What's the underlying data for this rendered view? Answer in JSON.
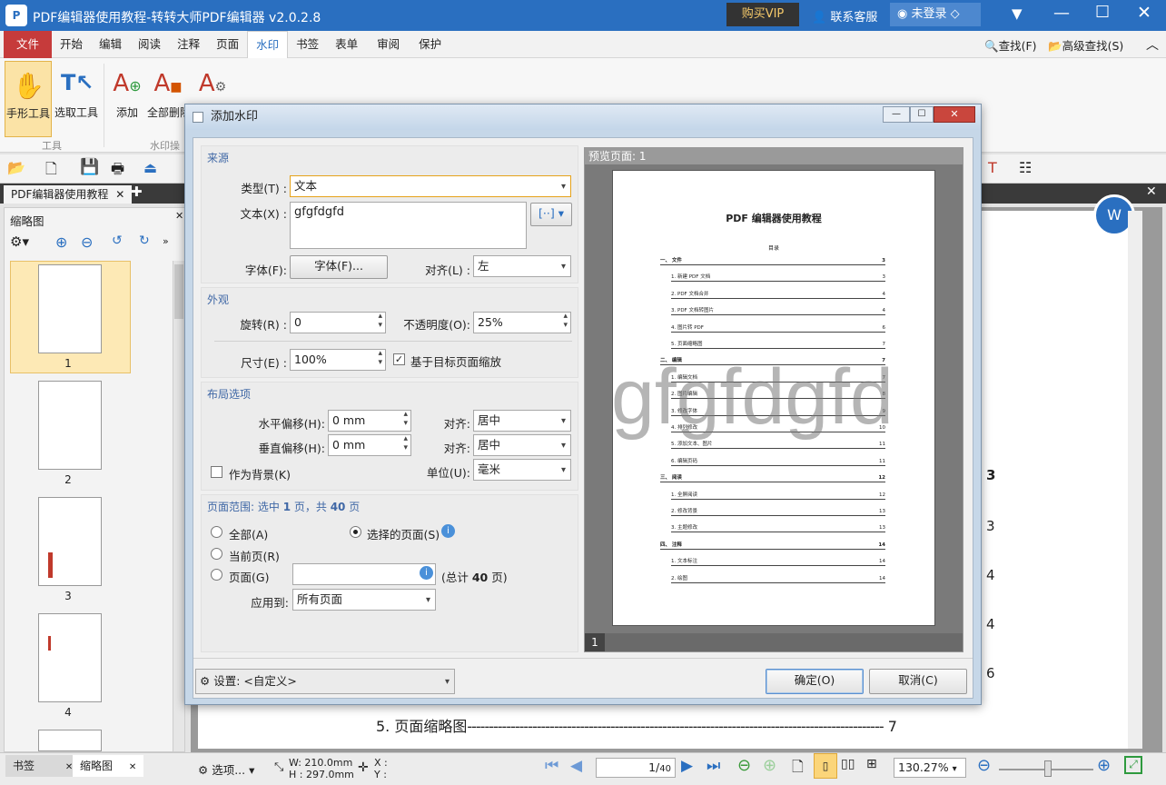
{
  "app": {
    "title": "PDF编辑器使用教程-转转大师PDF编辑器 v2.0.2.8",
    "vip": "购买VIP",
    "support": "联系客服",
    "login": "未登录"
  },
  "menu": {
    "items": [
      "文件",
      "开始",
      "编辑",
      "阅读",
      "注释",
      "页面",
      "水印",
      "书签",
      "表单",
      "审阅",
      "保护"
    ],
    "find": "查找(F)",
    "adv_find": "高级查找(S)"
  },
  "ribbon": {
    "hand": "手形工具",
    "select": "选取工具",
    "add": "添加",
    "delete_all": "全部删除",
    "group_tools": "工具",
    "group_wm": "水印操"
  },
  "doc_tab": "PDF编辑器使用教程",
  "left_panel": {
    "title": "缩略图",
    "pages": [
      "1",
      "2",
      "3",
      "4"
    ]
  },
  "document": {
    "lines": [
      {
        "label": "5.  页面缩略图",
        "page": "7"
      }
    ],
    "side_nums": [
      "3",
      "3",
      "4",
      "4",
      "6"
    ]
  },
  "status": {
    "bookmarks": "书签",
    "thumbs": "缩略图",
    "options": "选项...",
    "size_w": "W: 210.0mm",
    "size_h": "H : 297.0mm",
    "x": "X :",
    "y": "Y :",
    "page": "1",
    "total": "40",
    "zoom": "130.27%"
  },
  "dialog": {
    "title": "添加水印",
    "source": {
      "header": "来源",
      "type_label": "类型(T) :",
      "type_value": "文本",
      "text_label": "文本(X) :",
      "text_value": "gfgfdgfd",
      "font_label": "字体(F):",
      "font_button": "字体(F)...",
      "align_label": "对齐(L) :",
      "align_value": "左"
    },
    "appearance": {
      "header": "外观",
      "rotate_label": "旋转(R) :",
      "rotate_value": "0",
      "opacity_label": "不透明度(O):",
      "opacity_value": "25%",
      "size_label": "尺寸(E) :",
      "size_value": "100%",
      "scale_check": "基于目标页面缩放"
    },
    "layout": {
      "header": "布局选项",
      "h_offset_label": "水平偏移(H):",
      "h_offset_value": "0 mm",
      "v_offset_label": "垂直偏移(H):",
      "v_offset_value": "0 mm",
      "align1_label": "对齐:",
      "align1_value": "居中",
      "align2_label": "对齐:",
      "align2_value": "居中",
      "background_check": "作为背景(K)",
      "unit_label": "单位(U):",
      "unit_value": "毫米"
    },
    "range": {
      "header_prefix": "页面范围: 选中 ",
      "selected": "1",
      "header_mid": " 页，共 ",
      "total": "40",
      "header_suffix": " 页",
      "all": "全部(A)",
      "selected_pages": "选择的页面(S)",
      "current": "当前页(R)",
      "pages": "页面(G)",
      "pages_total_prefix": "(总计 ",
      "pages_total_suffix": " 页)",
      "apply_label": "应用到:",
      "apply_value": "所有页面"
    },
    "settings": {
      "label": "设置:",
      "value": "<自定义>"
    },
    "ok": "确定(O)",
    "cancel": "取消(C)",
    "preview": {
      "header": "预览页面: 1",
      "page_num": "1",
      "doc_title": "PDF 编辑器使用教程",
      "toc": "目录",
      "watermark": "gfgfdgfd",
      "entries": [
        {
          "t": "一、 文件",
          "p": "3"
        },
        {
          "t": "1. 新建 PDF 文档",
          "p": "3"
        },
        {
          "t": "2. PDF 文档合并",
          "p": "4"
        },
        {
          "t": "3. PDF 文档转图片",
          "p": "4"
        },
        {
          "t": "4. 图片转 PDF",
          "p": "6"
        },
        {
          "t": "5. 页面缩略图",
          "p": "7"
        },
        {
          "t": "二、 编辑",
          "p": "7"
        },
        {
          "t": "1. 编辑文档",
          "p": "7"
        },
        {
          "t": "2. 图片编辑",
          "p": "8"
        },
        {
          "t": "3. 修改字体",
          "p": "9"
        },
        {
          "t": "4. 排列修改",
          "p": "10"
        },
        {
          "t": "5. 添加文本、图片",
          "p": "11"
        },
        {
          "t": "6. 编辑页码",
          "p": "11"
        },
        {
          "t": "三、 阅读",
          "p": "12"
        },
        {
          "t": "1. 全屏阅读",
          "p": "12"
        },
        {
          "t": "2. 修改背景",
          "p": "13"
        },
        {
          "t": "3. 主题修改",
          "p": "13"
        },
        {
          "t": "四、 注释",
          "p": "14"
        },
        {
          "t": "1. 文本标注",
          "p": "14"
        },
        {
          "t": "2. 绘图",
          "p": "14"
        }
      ]
    }
  }
}
